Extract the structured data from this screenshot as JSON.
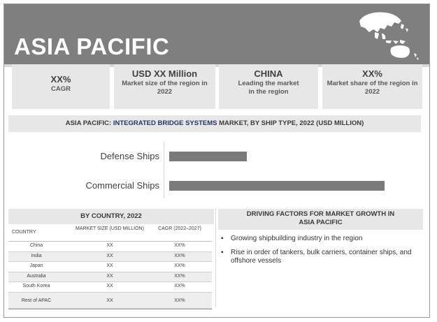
{
  "header": {
    "title": "ASIA PACIFIC"
  },
  "stats": [
    {
      "big": "XX%",
      "small": "CAGR"
    },
    {
      "big": "USD XX Million",
      "small": "Market size of the region in 2022"
    },
    {
      "big": "CHINA",
      "small": "Leading the market in the region"
    },
    {
      "big": "XX%",
      "small": "Market share of the region in 2022"
    }
  ],
  "bar_title": {
    "prefix": "ASIA PACIFIC: ",
    "highlight": "INTEGRATED BRIDGE SYSTEMS",
    "suffix": " MARKET, BY SHIP TYPE, 2022 (USD MILLION)"
  },
  "chart_data": {
    "type": "bar",
    "orientation": "horizontal",
    "title": "ASIA PACIFIC: INTEGRATED BRIDGE SYSTEMS MARKET, BY SHIP TYPE, 2022 (USD MILLION)",
    "categories": [
      "Defense Ships",
      "Commercial Ships"
    ],
    "values": [
      36,
      100
    ],
    "xlim": [
      0,
      100
    ],
    "color": "#7a7a7a",
    "grid": false
  },
  "country_panel": {
    "title": "BY COUNTRY, 2022",
    "headers": {
      "country": "COUNTRY",
      "size": "MARKET SIZE (USD MILLION)",
      "cagr": "CAGR (2022–2027)"
    },
    "rows": [
      {
        "country": "China",
        "size": "XX",
        "cagr": "XX%"
      },
      {
        "country": "India",
        "size": "XX",
        "cagr": "XX%"
      },
      {
        "country": "Japan",
        "size": "XX",
        "cagr": "XX%"
      },
      {
        "country": "Australia",
        "size": "XX",
        "cagr": "XX%"
      },
      {
        "country": "South Korea",
        "size": "XX",
        "cagr": "XX%"
      },
      {
        "country": "Rest of APAC",
        "size": "XX",
        "cagr": "XX%"
      }
    ]
  },
  "drivers_panel": {
    "title": "DRIVING FACTORS FOR MARKET GROWTH IN ASIA PACIFIC",
    "items": [
      "Growing shipbuilding industry in the region",
      "Rise in order of tankers, bulk carriers, container ships, and offshore vessels"
    ]
  }
}
